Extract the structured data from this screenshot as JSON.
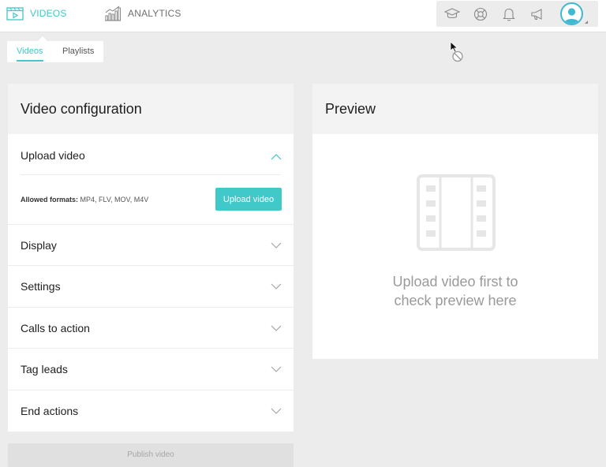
{
  "nav": {
    "videos_label": "VIDEOS",
    "analytics_label": "ANALYTICS",
    "accent_color": "#3fc7c9"
  },
  "toolbar_icons": [
    "graduation-cap-icon",
    "lifebuoy-icon",
    "bell-icon",
    "megaphone-icon",
    "user-avatar-icon"
  ],
  "subtabs": {
    "videos": "Videos",
    "playlists": "Playlists",
    "active": "Videos"
  },
  "config": {
    "title": "Video configuration",
    "upload": {
      "title": "Upload video",
      "formats_label": "Allowed formats:",
      "formats_value": "MP4, FLV, MOV, M4V",
      "button": "Upload video",
      "expanded": true
    },
    "sections": [
      {
        "label": "Display"
      },
      {
        "label": "Settings"
      },
      {
        "label": "Calls to action"
      },
      {
        "label": "Tag leads"
      },
      {
        "label": "End actions"
      }
    ]
  },
  "publish_label": "Publish video",
  "preview": {
    "title": "Preview",
    "message_line1": "Upload video first to",
    "message_line2": "check preview here"
  }
}
